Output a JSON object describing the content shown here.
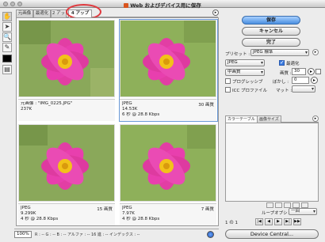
{
  "window": {
    "title": "Web およびデバイス用に保存"
  },
  "tools": [
    "hand-icon",
    "slice-select-icon",
    "zoom-icon",
    "eyedropper-icon"
  ],
  "tabs": [
    {
      "label": "元画像"
    },
    {
      "label": "最適化"
    },
    {
      "label": "2 アップ"
    },
    {
      "label": "4 アップ"
    }
  ],
  "previews": [
    {
      "line1": "元画像 : \"IMG_0225.JPG\"",
      "line2": "237K",
      "line3": "",
      "quality": ""
    },
    {
      "line1": "JPEG",
      "line2": "14.53K",
      "line3": "6 秒 @ 28.8 Kbps",
      "quality": "30 画質"
    },
    {
      "line1": "JPEG",
      "line2": "9.299K",
      "line3": "4 秒 @ 28.8 Kbps",
      "quality": "15 画質"
    },
    {
      "line1": "JPEG",
      "line2": "7.97K",
      "line3": "4 秒 @ 28.8 Kbps",
      "quality": "7 画質"
    }
  ],
  "status": {
    "zoom": "100%",
    "text": "R : --   G : --   B : --   アルファ : --   16 進 : --   インデックス : --"
  },
  "buttons": {
    "save": "保存",
    "cancel": "キャンセル",
    "done": "完了"
  },
  "settings": {
    "preset_label": "プリセット :",
    "preset_value": "JPEG 標準",
    "format": "JPEG",
    "optimize_label": "最適化",
    "quality_level": "中画質",
    "quality_label": "画質 :",
    "quality_value": "30",
    "progressive_label": "プログレッシブ",
    "blur_label": "ぼかし :",
    "blur_value": "0",
    "icc_label": "ICC プロファイル",
    "matte_label": "マット :"
  },
  "color_table": {
    "tab1": "カラーテーブル",
    "tab2": "画像サイズ"
  },
  "loop": {
    "label": "ループオプション :",
    "value": "一回"
  },
  "page_nav": {
    "label": "1 の 1"
  },
  "device_central": "Device Central..."
}
